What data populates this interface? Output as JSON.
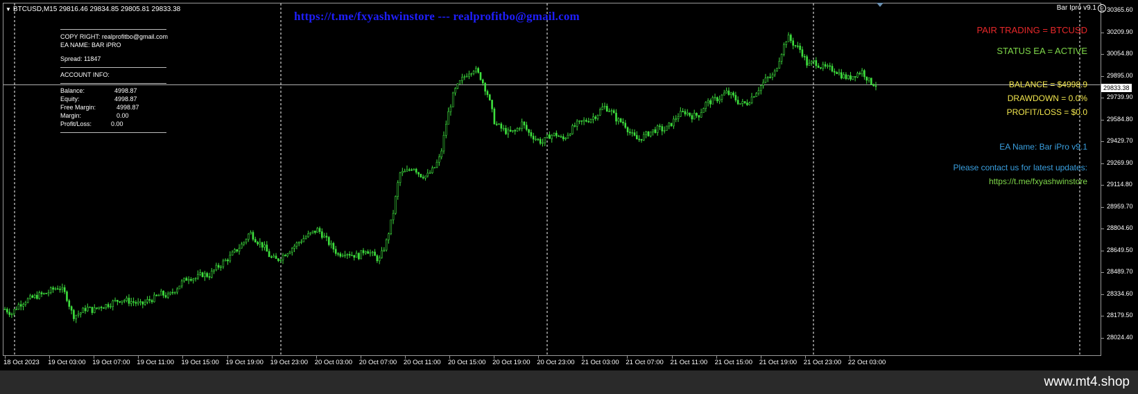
{
  "symbol_header": {
    "arrow": "▼",
    "text": "BTCUSD,M15  29816.46 29834.85 29805.81 29833.38"
  },
  "banner": "https://t.me/fxyashwinstore --- realprofitbo@gmail.com",
  "info": {
    "copyright": "COPY RIGHT: realprofitbo@gmail.com",
    "ea_name": "EA NAME: BAR iPRO",
    "spread": "Spread: 11847",
    "account_info": "ACCOUNT INFO:",
    "account": [
      {
        "label": "Balance:",
        "value": "4998.87"
      },
      {
        "label": "Equity:",
        "value": "4998.87"
      },
      {
        "label": "Free Margin:",
        "value": "4998.87"
      },
      {
        "label": "Margin:",
        "value": "0.00"
      },
      {
        "label": "Profit/Loss:",
        "value": "0.00"
      }
    ]
  },
  "ea_title": "Bar Ipro v9.1",
  "panel": {
    "pair": "PAIR TRADING = BTCUSD",
    "status": "STATUS EA = ACTIVE",
    "balance": "BALANCE = $4998.9",
    "drawdown": "DRAWDOWN = 0.0%",
    "profit_loss": "PROFIT/LOSS = $0.0",
    "ea_name": "EA Name: Bar iPro v9.1",
    "contact": "Please contact us for latest updates:",
    "contact_url": "https://t.me/fxyashwinstore"
  },
  "current_price": "29833.38",
  "price_axis": [
    "30365.60",
    "30209.90",
    "30054.80",
    "29895.00",
    "29739.90",
    "29584.80",
    "29429.70",
    "29269.90",
    "29114.80",
    "28959.70",
    "28804.60",
    "28649.50",
    "28489.70",
    "28334.60",
    "28179.50",
    "28024.40"
  ],
  "time_axis": [
    "18 Oct 2023",
    "19 Oct 03:00",
    "19 Oct 07:00",
    "19 Oct 11:00",
    "19 Oct 15:00",
    "19 Oct 19:00",
    "19 Oct 23:00",
    "20 Oct 03:00",
    "20 Oct 07:00",
    "20 Oct 11:00",
    "20 Oct 15:00",
    "20 Oct 19:00",
    "20 Oct 23:00",
    "21 Oct 03:00",
    "21 Oct 07:00",
    "21 Oct 11:00",
    "21 Oct 15:00",
    "21 Oct 19:00",
    "21 Oct 23:00",
    "22 Oct 03:00"
  ],
  "watermark": "www.mt4.shop",
  "colors": {
    "candle": "#3ee03e",
    "grid_dashed": "#ffffff",
    "price_line": "#b0b0b0",
    "background": "#000000"
  },
  "chart_data": {
    "type": "line",
    "series": [
      {
        "values": [
          28230,
          28200,
          28260,
          28290,
          28310,
          28330,
          28340,
          28370,
          28390,
          28330,
          28180,
          28200,
          28240,
          28220,
          28250,
          28260,
          28280,
          28300,
          28290,
          28280,
          28260,
          28290,
          28310,
          28340,
          28320,
          28370,
          28420,
          28460,
          28450,
          28480,
          28470,
          28520,
          28560,
          28600,
          28650,
          28700,
          28780,
          28720,
          28680,
          28600,
          28580,
          28620,
          28660,
          28700,
          28740,
          28770,
          28800,
          28740,
          28680,
          28620,
          28640,
          28620,
          28610,
          28660,
          28620,
          28580,
          28700,
          28900,
          29200,
          29210,
          29250,
          29190,
          29180,
          29230,
          29320,
          29600,
          29780,
          29860,
          29920,
          29950,
          29880,
          29760,
          29560,
          29520,
          29490,
          29500,
          29560,
          29490,
          29450,
          29420,
          29470,
          29480,
          29440,
          29500,
          29550,
          29570,
          29590,
          29620,
          29680,
          29650,
          29580,
          29560,
          29480,
          29440,
          29470,
          29500,
          29520,
          29510,
          29560,
          29620,
          29640,
          29610,
          29620,
          29700,
          29720,
          29740,
          29780,
          29750,
          29700,
          29700,
          29760,
          29820,
          29880,
          29900,
          30050,
          30180,
          30120,
          30080,
          29970,
          30000,
          29960,
          29950,
          29940,
          29900,
          29880,
          29910,
          29930,
          29860,
          29833
        ]
      }
    ],
    "ylim": [
      28024.4,
      30365.6
    ],
    "xlim_labels": [
      "18 Oct 2023",
      "22 Oct 03:00"
    ]
  }
}
